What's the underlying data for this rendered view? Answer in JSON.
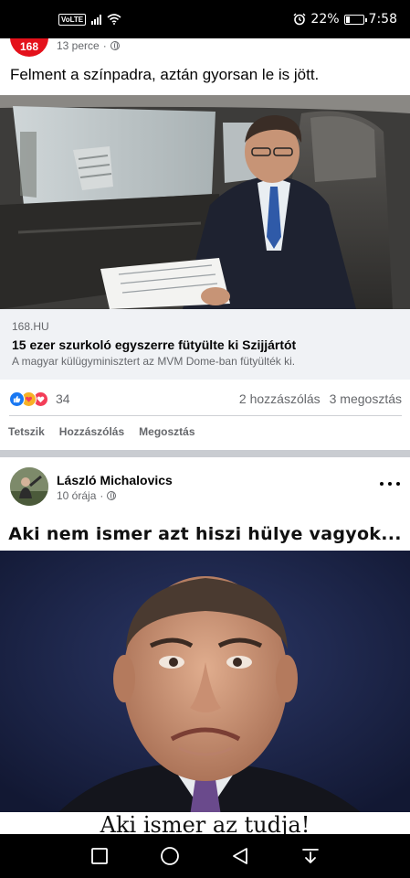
{
  "status_bar": {
    "volte": "VoLTE",
    "battery": "22%",
    "time": "7:58",
    "battery_level": 0.22
  },
  "post1": {
    "avatar_text": "168",
    "time": "13 perce",
    "separator": "·",
    "text": "Felment a színpadra, aztán gyorsan le is jött.",
    "link": {
      "domain": "168.HU",
      "title": "15 ezer szurkoló egyszerre fütyülte ki Szijjártót",
      "description": "A magyar külügyminisztert az MVM Dome-ban fütyülték ki."
    },
    "reactions": {
      "count": "34",
      "comments": "2 hozzászólás",
      "shares": "3 megosztás"
    },
    "actions": {
      "like": "Tetszik",
      "comment": "Hozzászólás",
      "share": "Megosztás"
    }
  },
  "post2": {
    "author": "László Michalovics",
    "time": "10 órája",
    "separator": "·",
    "meme_top": "Aki nem ismer azt hiszi hülye vagyok...",
    "meme_bottom": "Aki ismer az tudja!"
  },
  "colors": {
    "facebook_blue": "#1877f2",
    "brand_168": "#e4111b",
    "secondary_text": "#65676b",
    "link_card_bg": "#f0f2f5"
  },
  "icons": {
    "wifi": "wifi-icon",
    "alarm": "alarm-icon",
    "globe": "globe-icon",
    "more": "more-dots-icon",
    "nav_recent": "square-icon",
    "nav_home": "circle-icon",
    "nav_back": "triangle-back-icon",
    "nav_down": "pull-down-icon"
  }
}
